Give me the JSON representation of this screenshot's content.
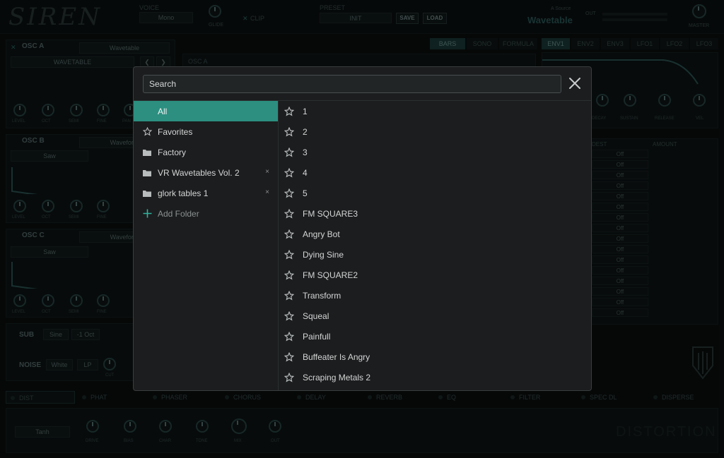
{
  "synth": {
    "logo": "SIREN",
    "voice_label": "VOICE",
    "voice_value": "Mono",
    "glide_label": "GLIDE",
    "clip_label": "CLIP",
    "preset_label": "PRESET",
    "preset_value": "INIT",
    "save_label": "SAVE",
    "load_label": "LOAD",
    "source_label": "A Source",
    "source_value": "Wavetable",
    "out_label": "OUT",
    "master_label": "MASTER",
    "view_tabs": [
      "BARS",
      "SONO",
      "FORMULA"
    ],
    "env_tabs": [
      "ENV1",
      "ENV2",
      "ENV3",
      "LFO1",
      "LFO2",
      "LFO3"
    ],
    "env_knobs": [
      "DECAY",
      "SUSTAIN",
      "RELEASE",
      "VEL"
    ],
    "osc_a": {
      "title": "OSC A",
      "mode": "Wavetable",
      "display": "WAVETABLE",
      "arrows": [
        "❮",
        "❯"
      ]
    },
    "osc_b": {
      "title": "OSC B",
      "mode": "Waveform",
      "wave": "Saw"
    },
    "osc_c": {
      "title": "OSC C",
      "mode": "Waveform",
      "wave": "Saw"
    },
    "view_title": "OSC A",
    "osc_knobs": [
      "LEVEL",
      "OCT",
      "SEMI",
      "FINE",
      "PAN"
    ],
    "sub": {
      "title": "SUB",
      "wave": "Sine",
      "oct": "-1 Oct"
    },
    "noise": {
      "title": "NOISE",
      "type": "White",
      "filter": "LP",
      "cut": "CUT"
    },
    "mod_headers": [
      "DEST",
      "AMOUNT"
    ],
    "mod_value": "Off",
    "fx_tabs": [
      "DIST",
      "PHAT",
      "PHASER",
      "CHORUS",
      "DELAY",
      "REVERB",
      "EQ",
      "FILTER",
      "SPEC DL",
      "DISPERSE"
    ],
    "dist_mode": "Tanh",
    "dist_knobs": [
      "DRIVE",
      "BIAS",
      "CHAR",
      "TONE",
      "MIX",
      "OUT"
    ],
    "dist_title": "DISTORTION"
  },
  "browser": {
    "search_placeholder": "Search",
    "folders": [
      {
        "label": "All",
        "icon": "none",
        "active": true
      },
      {
        "label": "Favorites",
        "icon": "star-icon"
      },
      {
        "label": "Factory",
        "icon": "folder-icon"
      },
      {
        "label": "VR Wavetables Vol. 2",
        "icon": "folder-icon",
        "removable": true
      },
      {
        "label": "glork tables 1",
        "icon": "folder-icon",
        "removable": true
      }
    ],
    "remove_glyph": "×",
    "add_folder_label": "Add Folder",
    "items": [
      "1",
      "2",
      "3",
      "4",
      "5",
      "FM SQUARE3",
      "Angry Bot",
      "Dying Sine",
      "FM SQUARE2",
      "Transform",
      "Squeal",
      "Painfull",
      "Buffeater Is Angry",
      "Scraping Metals 2"
    ],
    "colors": {
      "accent": "#2c8f80",
      "modal_bg": "#1b1d1e",
      "text": "#d4d6d6"
    }
  }
}
